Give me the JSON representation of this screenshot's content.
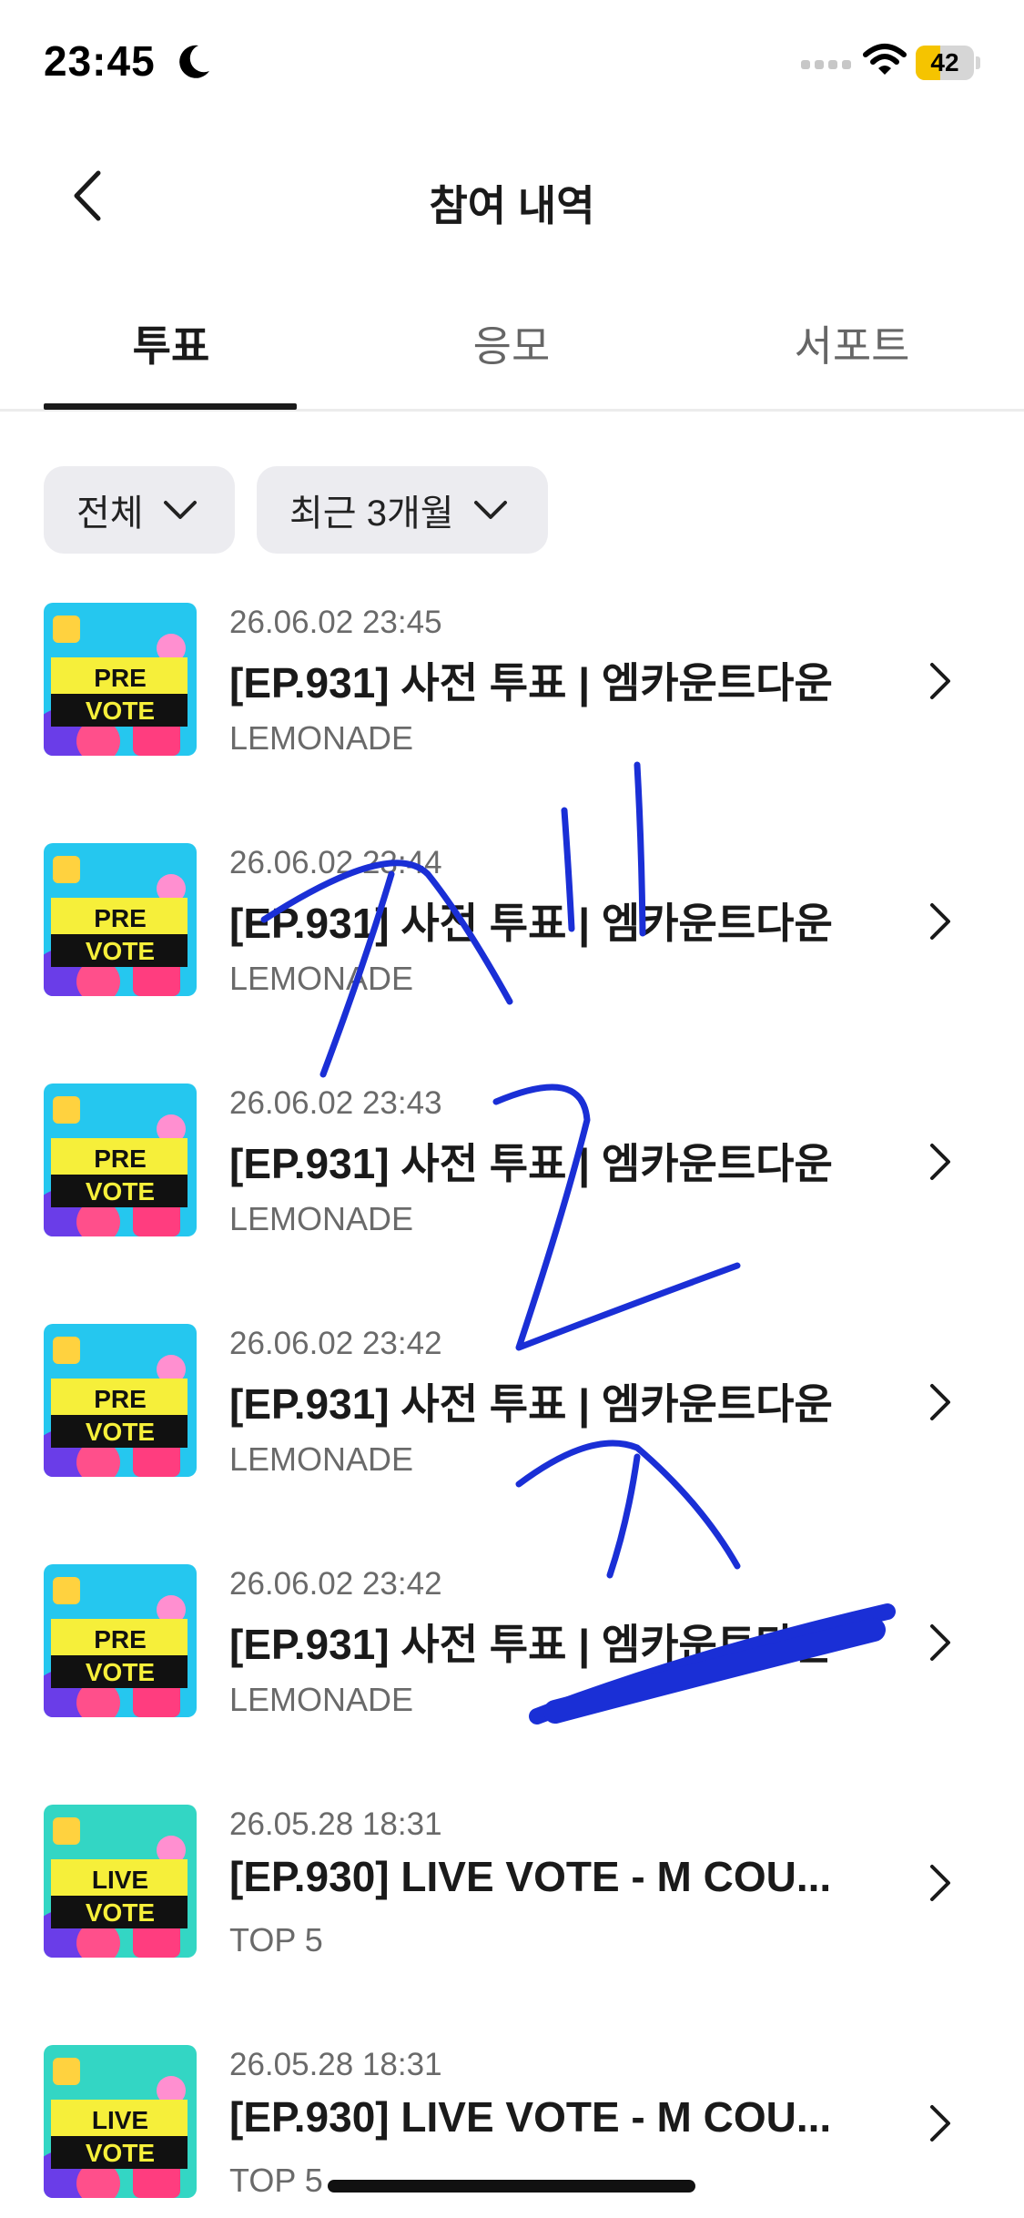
{
  "status_bar": {
    "time": "23:45",
    "battery": "42",
    "battery_level_percent": 42,
    "icons": [
      "moon-icon",
      "signal-icon",
      "wifi-icon",
      "charging-icon"
    ]
  },
  "header": {
    "title": "참여 내역",
    "back_icon": "chevron-left-icon"
  },
  "tabs": [
    {
      "label": "투표",
      "active": true
    },
    {
      "label": "응모",
      "active": false
    },
    {
      "label": "서포트",
      "active": false
    }
  ],
  "filters": {
    "category": "전체",
    "period": "최근 3개월"
  },
  "items": [
    {
      "date": "26.06.02 23:45",
      "title": "[EP.931] 사전 투표 | 엠카운트다운",
      "subtitle": "LEMONADE",
      "badge_top": "PRE",
      "badge_bottom": "VOTE"
    },
    {
      "date": "26.06.02 23:44",
      "title": "[EP.931] 사전 투표 | 엠카운트다운",
      "subtitle": "LEMONADE",
      "badge_top": "PRE",
      "badge_bottom": "VOTE"
    },
    {
      "date": "26.06.02 23:43",
      "title": "[EP.931] 사전 투표 | 엠카운트다운",
      "subtitle": "LEMONADE",
      "badge_top": "PRE",
      "badge_bottom": "VOTE"
    },
    {
      "date": "26.06.02 23:42",
      "title": "[EP.931] 사전 투표 | 엠카운트다운",
      "subtitle": "LEMONADE",
      "badge_top": "PRE",
      "badge_bottom": "VOTE"
    },
    {
      "date": "26.06.02 23:42",
      "title": "[EP.931] 사전 투표 | 엠카운트다운",
      "subtitle": "LEMONADE",
      "badge_top": "PRE",
      "badge_bottom": "VOTE"
    },
    {
      "date": "26.05.28 18:31",
      "title": "[EP.930] LIVE VOTE - M COU...",
      "subtitle": "TOP 5",
      "badge_top": "LIVE",
      "badge_bottom": "VOTE"
    },
    {
      "date": "26.05.28 18:31",
      "title": "[EP.930] LIVE VOTE - M COU...",
      "subtitle": "TOP 5",
      "badge_top": "LIVE",
      "badge_bottom": "VOTE"
    }
  ],
  "colors": {
    "handwriting": "#1a2fd6",
    "pre_vote_bg": "#25c7ef",
    "live_vote_bg": "#33d6c4",
    "badge_yellow": "#f6ef3a",
    "battery_yellow": "#f5c400"
  }
}
